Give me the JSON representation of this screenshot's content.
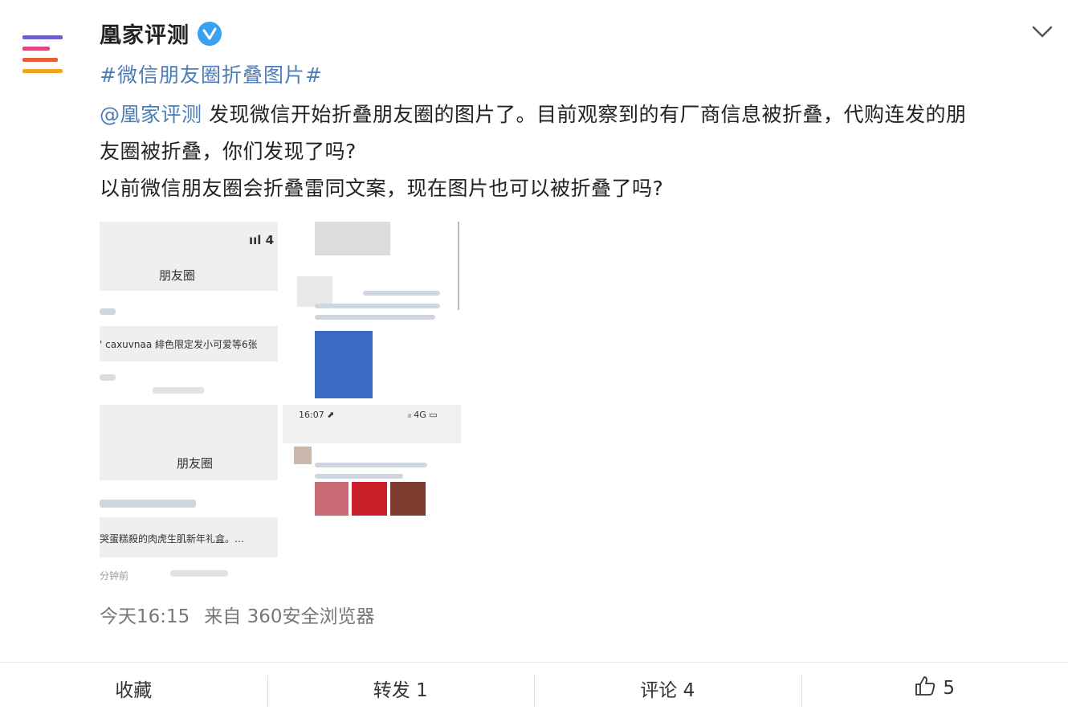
{
  "post": {
    "username": "凰家评测",
    "hashtag": "#微信朋友圈折叠图片#",
    "mention": "@凰家评测",
    "text_line_1": " 发现微信开始折叠朋友圈的图片了。目前观察到的有厂商信息被折叠，代购连发的朋",
    "text_line_2": "友圈被折叠，你们发现了吗?",
    "text_line_3": "以前微信朋友圈会折叠雷同文案，现在图片也可以被折叠了吗?",
    "time": "今天16:15",
    "source": "来自 360安全浏览器"
  },
  "images": {
    "img1_title": "朋友圈",
    "img1_signal": "ııl 4",
    "img1_text": "' caxuvnaa 緋色限定发小可爱等6张",
    "img3_title": "朋友圈",
    "img3_text": "哭蛋糕殺的肉虎生肌新年礼盒。…",
    "img3_footer": "分钟前",
    "img4_time": "16:07 ⬈",
    "img4_battery": "ᵢₗ 4G ▭"
  },
  "actions": {
    "favorite": "收藏",
    "repost": "转发 1",
    "comment": "评论 4",
    "like_count": "5"
  },
  "colors": {
    "link": "#4d7db8",
    "verified": "#3aa1f0",
    "avatar_bars": [
      "#6b5fcf",
      "#e0457b",
      "#e85d3c",
      "#f2a320"
    ]
  }
}
